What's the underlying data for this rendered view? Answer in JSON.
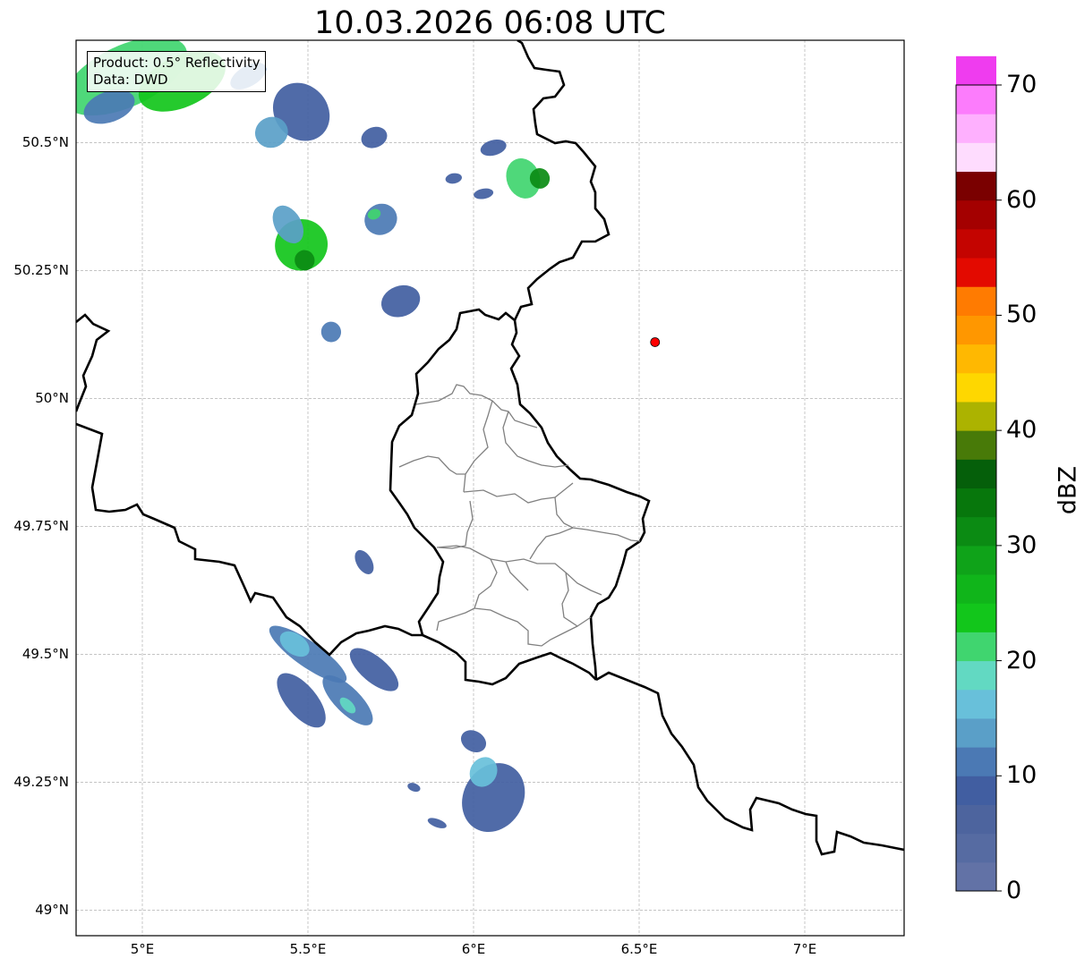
{
  "title": "10.03.2026 06:08 UTC",
  "info": {
    "product": "Product: 0.5° Reflectivity",
    "data": "Data: DWD"
  },
  "map": {
    "lon_range": [
      4.8,
      7.3
    ],
    "lat_range": [
      48.95,
      50.7
    ],
    "lat_ticks": [
      {
        "v": 50.5,
        "label": "50.5°N"
      },
      {
        "v": 50.25,
        "label": "50.25°N"
      },
      {
        "v": 50.0,
        "label": "50°N"
      },
      {
        "v": 49.75,
        "label": "49.75°N"
      },
      {
        "v": 49.5,
        "label": "49.5°N"
      },
      {
        "v": 49.25,
        "label": "49.25°N"
      },
      {
        "v": 49.0,
        "label": "49°N"
      }
    ],
    "lon_ticks": [
      {
        "v": 5.0,
        "label": "5°E"
      },
      {
        "v": 5.5,
        "label": "5.5°E"
      },
      {
        "v": 6.0,
        "label": "6°E"
      },
      {
        "v": 6.5,
        "label": "6.5°E"
      },
      {
        "v": 7.0,
        "label": "7°E"
      }
    ],
    "radar_site": {
      "lon": 6.548,
      "lat": 50.11,
      "color": "#ff0000"
    },
    "echoes": [
      {
        "lon": 4.95,
        "lat": 50.63,
        "rx": 0.2,
        "ry": 0.06,
        "angle": -25,
        "dbz": 22
      },
      {
        "lon": 5.12,
        "lat": 50.62,
        "rx": 0.14,
        "ry": 0.05,
        "angle": -25,
        "dbz": 24
      },
      {
        "lon": 4.9,
        "lat": 50.57,
        "rx": 0.08,
        "ry": 0.03,
        "angle": -20,
        "dbz": 12
      },
      {
        "lon": 5.32,
        "lat": 50.63,
        "rx": 0.06,
        "ry": 0.02,
        "angle": -30,
        "dbz": 10
      },
      {
        "lon": 5.48,
        "lat": 50.56,
        "rx": 0.08,
        "ry": 0.06,
        "angle": -40,
        "dbz": 8
      },
      {
        "lon": 5.39,
        "lat": 50.52,
        "rx": 0.05,
        "ry": 0.03,
        "angle": -20,
        "dbz": 14
      },
      {
        "lon": 5.7,
        "lat": 50.51,
        "rx": 0.04,
        "ry": 0.02,
        "angle": -20,
        "dbz": 8
      },
      {
        "lon": 6.15,
        "lat": 50.43,
        "rx": 0.05,
        "ry": 0.04,
        "angle": -20,
        "dbz": 22
      },
      {
        "lon": 6.2,
        "lat": 50.43,
        "rx": 0.03,
        "ry": 0.02,
        "angle": -20,
        "dbz": 30
      },
      {
        "lon": 6.06,
        "lat": 50.49,
        "rx": 0.04,
        "ry": 0.015,
        "angle": -15,
        "dbz": 8
      },
      {
        "lon": 5.94,
        "lat": 50.43,
        "rx": 0.025,
        "ry": 0.01,
        "angle": -10,
        "dbz": 8
      },
      {
        "lon": 6.03,
        "lat": 50.4,
        "rx": 0.03,
        "ry": 0.01,
        "angle": -10,
        "dbz": 8
      },
      {
        "lon": 5.48,
        "lat": 50.3,
        "rx": 0.08,
        "ry": 0.05,
        "angle": -25,
        "dbz": 24
      },
      {
        "lon": 5.44,
        "lat": 50.34,
        "rx": 0.04,
        "ry": 0.04,
        "angle": -30,
        "dbz": 14
      },
      {
        "lon": 5.49,
        "lat": 50.27,
        "rx": 0.03,
        "ry": 0.02,
        "angle": -20,
        "dbz": 30
      },
      {
        "lon": 5.72,
        "lat": 50.35,
        "rx": 0.05,
        "ry": 0.03,
        "angle": -30,
        "dbz": 10
      },
      {
        "lon": 5.7,
        "lat": 50.36,
        "rx": 0.02,
        "ry": 0.01,
        "angle": -20,
        "dbz": 20
      },
      {
        "lon": 5.78,
        "lat": 50.19,
        "rx": 0.06,
        "ry": 0.03,
        "angle": -20,
        "dbz": 9
      },
      {
        "lon": 5.57,
        "lat": 50.13,
        "rx": 0.03,
        "ry": 0.02,
        "angle": -10,
        "dbz": 10
      },
      {
        "lon": 5.5,
        "lat": 49.5,
        "rx": 0.14,
        "ry": 0.025,
        "angle": 35,
        "dbz": 10
      },
      {
        "lon": 5.46,
        "lat": 49.52,
        "rx": 0.05,
        "ry": 0.02,
        "angle": 35,
        "dbz": 15
      },
      {
        "lon": 5.7,
        "lat": 49.47,
        "rx": 0.09,
        "ry": 0.025,
        "angle": 40,
        "dbz": 8
      },
      {
        "lon": 5.48,
        "lat": 49.41,
        "rx": 0.1,
        "ry": 0.03,
        "angle": 50,
        "dbz": 9
      },
      {
        "lon": 5.62,
        "lat": 49.41,
        "rx": 0.1,
        "ry": 0.025,
        "angle": 45,
        "dbz": 10
      },
      {
        "lon": 5.62,
        "lat": 49.4,
        "rx": 0.03,
        "ry": 0.01,
        "angle": 45,
        "dbz": 18
      },
      {
        "lon": 5.67,
        "lat": 49.68,
        "rx": 0.04,
        "ry": 0.015,
        "angle": 60,
        "dbz": 9
      },
      {
        "lon": 6.06,
        "lat": 49.22,
        "rx": 0.09,
        "ry": 0.07,
        "angle": 30,
        "dbz": 9
      },
      {
        "lon": 6.03,
        "lat": 49.27,
        "rx": 0.04,
        "ry": 0.03,
        "angle": 30,
        "dbz": 16
      },
      {
        "lon": 6.0,
        "lat": 49.33,
        "rx": 0.04,
        "ry": 0.02,
        "angle": 30,
        "dbz": 8
      },
      {
        "lon": 5.89,
        "lat": 49.17,
        "rx": 0.03,
        "ry": 0.008,
        "angle": 20,
        "dbz": 8
      },
      {
        "lon": 5.82,
        "lat": 49.24,
        "rx": 0.02,
        "ry": 0.008,
        "angle": 20,
        "dbz": 8
      }
    ]
  },
  "colorbar": {
    "label": "dBZ",
    "min": 0,
    "max": 70,
    "step": 2.5,
    "colors": [
      "#6272a6",
      "#566ba2",
      "#4d649e",
      "#415ea1",
      "#4b79b4",
      "#5a9fc8",
      "#68c0da",
      "#62d9c2",
      "#40d56f",
      "#12c61b",
      "#10b51a",
      "#0fa319",
      "#0b8b13",
      "#07770c",
      "#055f0a",
      "#487a08",
      "#acb300",
      "#fed700",
      "#ffb801",
      "#ff9700",
      "#ff7b01",
      "#e30a00",
      "#c40400",
      "#a40000",
      "#7a0000",
      "#fedcfe",
      "#feb0fe",
      "#fc7cfc",
      "#ef3cef"
    ],
    "ticks": [
      {
        "v": 0,
        "label": "0"
      },
      {
        "v": 10,
        "label": "10"
      },
      {
        "v": 20,
        "label": "20"
      },
      {
        "v": 30,
        "label": "30"
      },
      {
        "v": 40,
        "label": "40"
      },
      {
        "v": 50,
        "label": "50"
      },
      {
        "v": 60,
        "label": "60"
      },
      {
        "v": 70,
        "label": "70"
      }
    ]
  }
}
